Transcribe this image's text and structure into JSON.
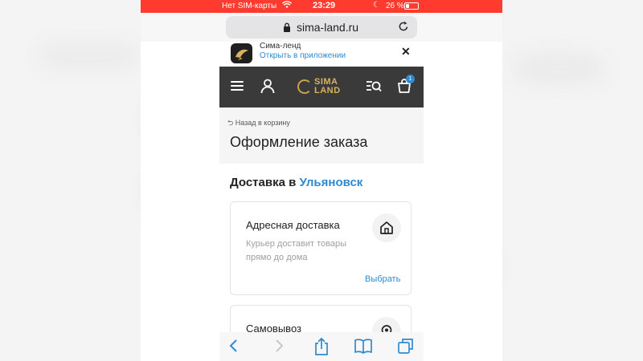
{
  "status_bar": {
    "carrier": "Нет SIM-карты",
    "time": "23:29",
    "battery_percent": "26 %",
    "battery_level": 0.26,
    "background_color": "#ff3b30"
  },
  "browser": {
    "url": "sima-land.ru",
    "lock_icon": "lock-icon",
    "reload_icon": "reload-icon"
  },
  "app_banner": {
    "app_name": "Сима-ленд",
    "open_label": "Открыть в приложении",
    "close_label": "✕"
  },
  "header": {
    "logo_line1": "SIMA",
    "logo_line2": "LAND",
    "cart_count": "1",
    "accent_color": "#d8b25c",
    "background_color": "#3a3a3a"
  },
  "page": {
    "back_label": "⮌ Назад в корзину",
    "title": "Оформление заказа",
    "delivery_heading_prefix": "Доставка в ",
    "delivery_city": "Ульяновск",
    "link_color": "#2f8ad0"
  },
  "options": [
    {
      "title": "Адресная доставка",
      "description": "Курьер доставит товары прямо до дома",
      "select_label": "Выбрать",
      "icon": "home-icon"
    },
    {
      "title": "Самовывоз",
      "icon": "pickup-point-icon"
    }
  ],
  "toolbar": {
    "icons": [
      "back-icon",
      "forward-icon",
      "share-icon",
      "bookmarks-icon",
      "tabs-icon"
    ]
  }
}
